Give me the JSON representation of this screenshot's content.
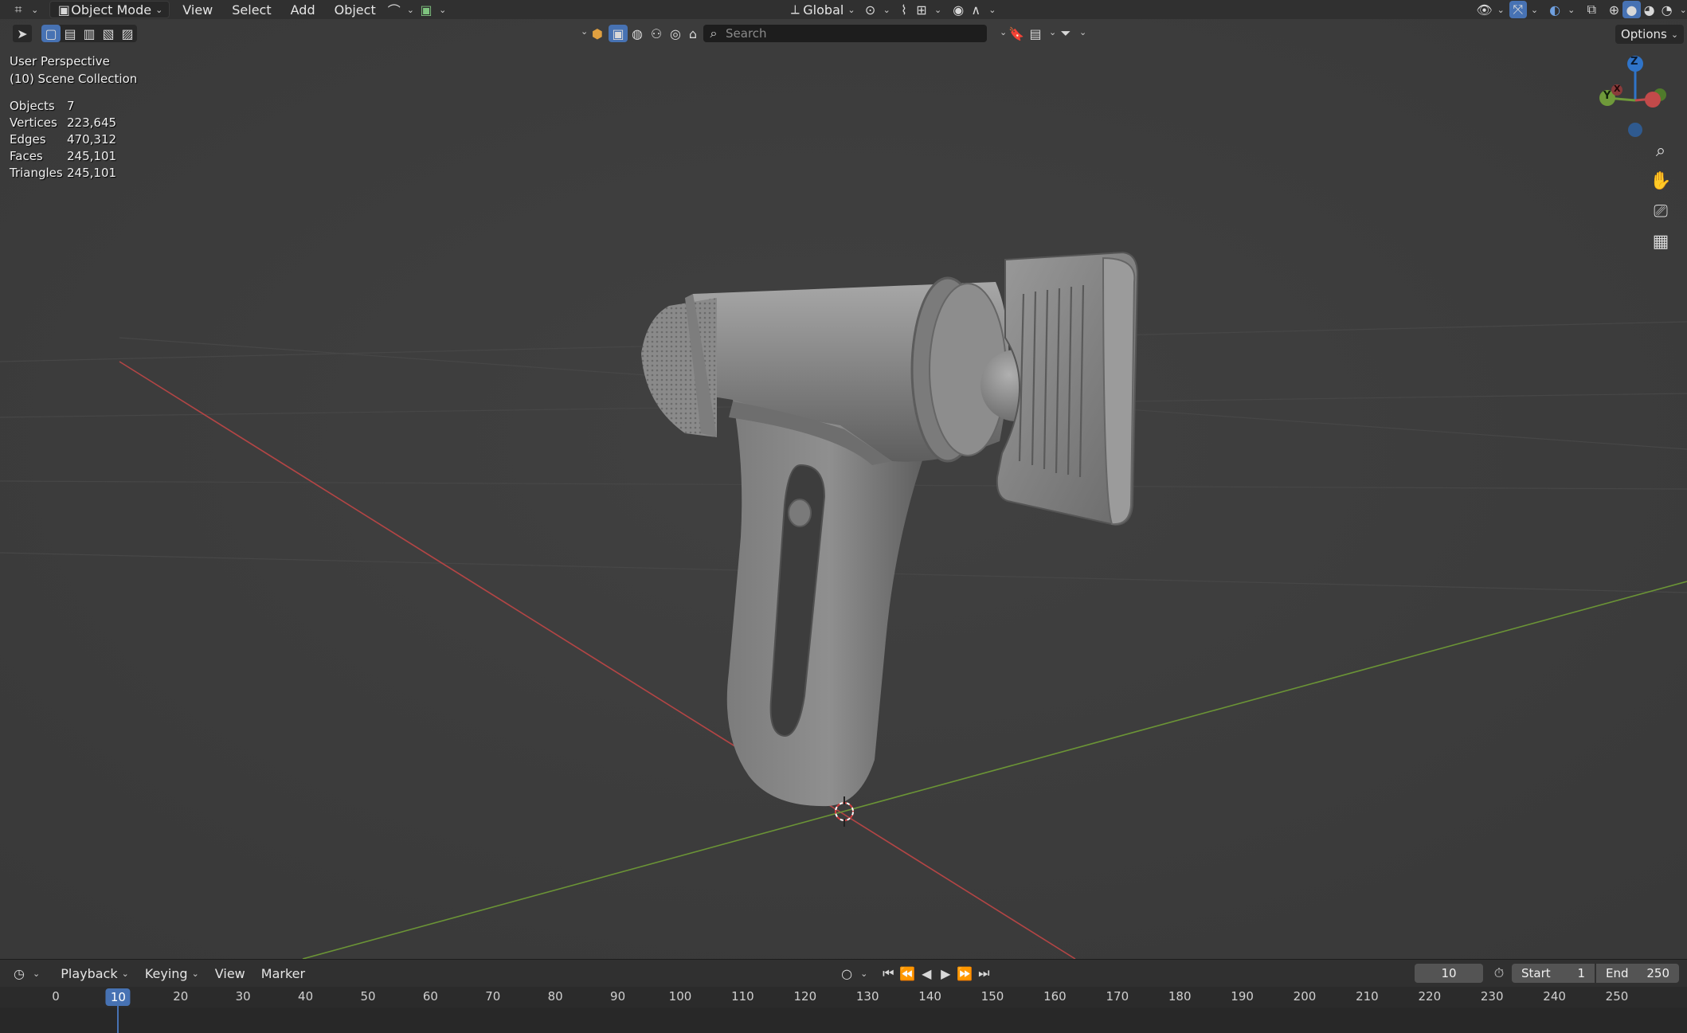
{
  "header": {
    "mode": "Object Mode",
    "menu": [
      "View",
      "Select",
      "Add",
      "Object"
    ],
    "transform_orientation": "Global"
  },
  "toolbar": {
    "search_placeholder": "Search",
    "options_label": "Options"
  },
  "viewport": {
    "perspective_label": "User Perspective",
    "collection_label": "(10) Scene Collection",
    "stats": [
      {
        "label": "Objects",
        "value": "7"
      },
      {
        "label": "Vertices",
        "value": "223,645"
      },
      {
        "label": "Edges",
        "value": "470,312"
      },
      {
        "label": "Faces",
        "value": "245,101"
      },
      {
        "label": "Triangles",
        "value": "245,101"
      }
    ],
    "gizmo_axes": [
      "Z",
      "Y",
      "X"
    ]
  },
  "timeline": {
    "menu": [
      "Playback",
      "Keying",
      "View",
      "Marker"
    ],
    "current_frame": "10",
    "start_label": "Start",
    "start_value": "1",
    "end_label": "End",
    "end_value": "250",
    "ruler_ticks": [
      "0",
      "10",
      "20",
      "30",
      "40",
      "50",
      "60",
      "70",
      "80",
      "90",
      "100",
      "110",
      "120",
      "130",
      "140",
      "150",
      "160",
      "170",
      "180",
      "190",
      "200",
      "210",
      "220",
      "230",
      "240",
      "250"
    ],
    "playhead_frame": "10"
  },
  "colors": {
    "accent": "#4772b3",
    "x_axis": "#c24a4a",
    "y_axis": "#6f9a3a",
    "z_axis": "#2f74c9",
    "viewport_bg": "#3d3d3d",
    "header_bg": "#303030"
  }
}
